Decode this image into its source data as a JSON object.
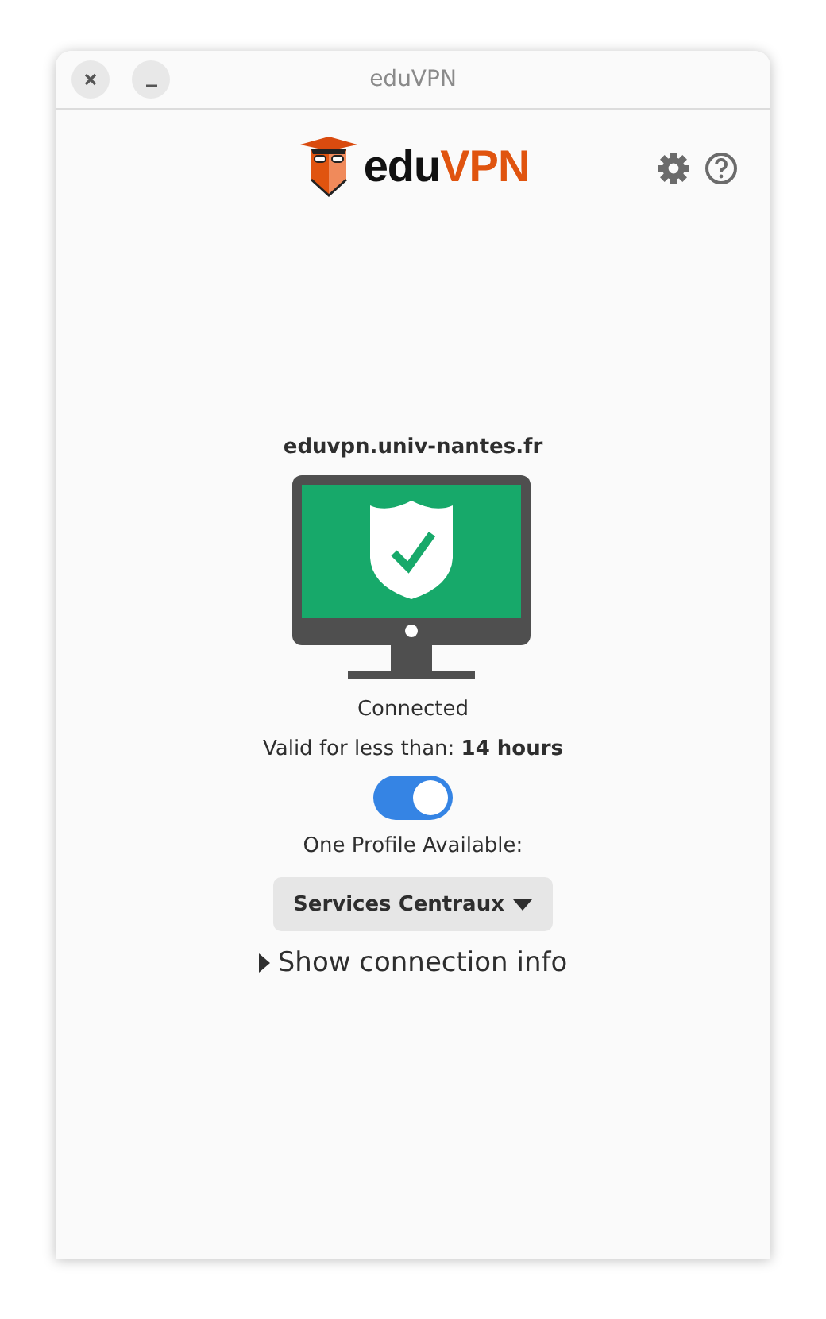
{
  "window": {
    "title": "eduVPN"
  },
  "logo": {
    "prefix": "edu",
    "suffix": "VPN"
  },
  "server": {
    "name": "eduvpn.univ-nantes.fr"
  },
  "status": {
    "connected": true,
    "text": "Connected"
  },
  "validity": "Valid for less than: **14 hours**",
  "toggle": {
    "on": true
  },
  "profiles": {
    "label": "One Profile Available:",
    "selected": "Services Centraux"
  },
  "connection_info": {
    "label": "Show connection info",
    "expanded": false
  }
}
